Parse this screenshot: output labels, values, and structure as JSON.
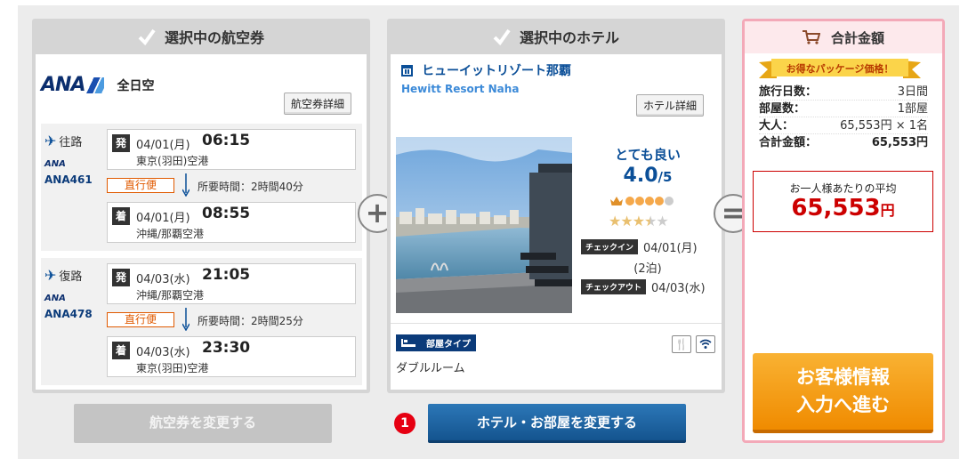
{
  "flight_panel": {
    "header": "選択中の航空券",
    "airline_logo_text": "ANA",
    "airline_name": "全日空",
    "detail_button": "航空券詳細",
    "legs": [
      {
        "label": "往路",
        "logo_text": "ANA",
        "flight_no": "ANA461",
        "dep_badge": "発",
        "dep_date": "04/01(月)",
        "dep_time": "06:15",
        "dep_airport": "東京(羽田)空港",
        "direct_label": "直行便",
        "duration": "所要時間：2時間40分",
        "arr_badge": "着",
        "arr_date": "04/01(月)",
        "arr_time": "08:55",
        "arr_airport": "沖縄/那覇空港"
      },
      {
        "label": "復路",
        "logo_text": "ANA",
        "flight_no": "ANA478",
        "dep_badge": "発",
        "dep_date": "04/03(水)",
        "dep_time": "21:05",
        "dep_airport": "沖縄/那覇空港",
        "direct_label": "直行便",
        "duration": "所要時間：2時間25分",
        "arr_badge": "着",
        "arr_date": "04/03(水)",
        "arr_time": "23:30",
        "arr_airport": "東京(羽田)空港"
      }
    ]
  },
  "hotel_panel": {
    "header": "選択中のホテル",
    "name": "ヒューイットリゾート那覇",
    "name_en": "Hewitt Resort Naha",
    "detail_button": "ホテル詳細",
    "rating_word": "とても良い",
    "rating_score": "4.0",
    "rating_max": "/5",
    "crown_rating": 4,
    "star_rating": 3.5,
    "checkin_tag": "チェックイン",
    "checkin_date": "04/01(月)",
    "nights": "(2泊)",
    "checkout_tag": "チェックアウト",
    "checkout_date": "04/03(水)",
    "room_type_tag": "部屋タイプ",
    "room_type_name": "ダブルルーム",
    "amenity_icons": [
      "restaurant-icon",
      "wifi-icon"
    ]
  },
  "summary_panel": {
    "header": "合計金額",
    "ribbon": "お得なパッケージ価格！",
    "rows": [
      {
        "key": "旅行日数：",
        "value": "3日間"
      },
      {
        "key": "部屋数：",
        "value": "1部屋"
      },
      {
        "key": "大人：",
        "value": "65,553円 × 1名"
      },
      {
        "key": "合計金額：",
        "value": "65,553円"
      }
    ],
    "avg_label": "お一人様あたりの平均",
    "avg_price": "65,553",
    "avg_unit": "円",
    "proceed_button": "お客様情報\n入力へ進む"
  },
  "buttons": {
    "change_flight": "航空券を変更する",
    "change_hotel": "ホテル・お部屋を変更する",
    "step_number": "1"
  },
  "operators": {
    "plus": "+",
    "equals": "="
  },
  "colors": {
    "ana_blue": "#0b2e6e",
    "link_blue": "#0b4f98",
    "direct_orange": "#e05a00",
    "price_red": "#cc0000",
    "proceed_orange": "#f08b00",
    "change_hotel_blue": "#14548f",
    "summary_border_pink": "#f3a9b8"
  }
}
